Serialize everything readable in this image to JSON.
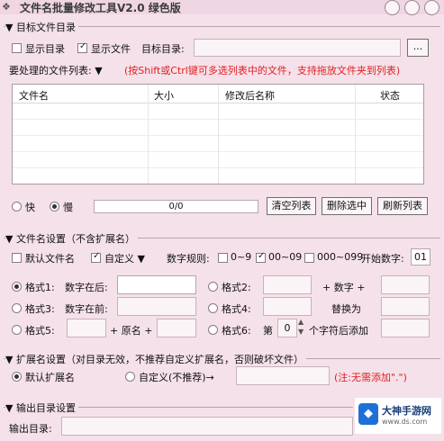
{
  "window": {
    "title": "文件名批量修改工具V2.0  绿色版",
    "icon": "app-icon"
  },
  "target_dir": {
    "group_title": "目标文件目录",
    "show_dirs_label": "显示目录",
    "show_dirs_checked": false,
    "show_files_label": "显示文件",
    "show_files_checked": true,
    "dir_label": "目标目录:",
    "dir_value": "",
    "browse_label": "..."
  },
  "file_list": {
    "heading": "要处理的文件列表: ▼",
    "hint": "(按Shift或Ctrl键可多选列表中的文件，支持拖放文件夹到列表)",
    "columns": [
      "文件名",
      "大小",
      "修改后名称",
      "状态"
    ],
    "rows": []
  },
  "speed": {
    "fast_label": "快",
    "slow_label": "慢",
    "selected": "slow"
  },
  "progress": {
    "text": "0/0",
    "fraction": 0
  },
  "actions": {
    "clear_label": "清空列表",
    "delete_label": "删除选中",
    "refresh_label": "刷新列表"
  },
  "filename": {
    "group_title": "文件名设置（不含扩展名）",
    "default_name_label": "默认文件名",
    "default_name_checked": false,
    "custom_label": "自定义 ▼",
    "custom_checked": true,
    "digit_rule_label": "数字规则:",
    "rule_0_9": "0~9",
    "rule_0_9_checked": false,
    "rule_00_99": "00~09",
    "rule_00_99_checked": true,
    "rule_000_099": "000~099",
    "rule_000_099_checked": false,
    "start_label": "开始数字:",
    "start_value": "01",
    "format1": "格式1:",
    "format1_desc": "数字在后:",
    "format2": "格式2:",
    "plus_digit": "+ 数字 +",
    "format3": "格式3:",
    "format3_desc": "数字在前:",
    "format4": "格式4:",
    "replace_label": "替换为",
    "format5": "格式5:",
    "plus_name_plus": "+ 原名 +",
    "format6": "格式6:",
    "format6_di": "第",
    "format6_count": "0",
    "format6_suffix": "个字符后添加",
    "selected_format": "format1"
  },
  "extension": {
    "group_title": "扩展名设置（对目录无效，不推荐自定义扩展名，否则破坏文件）",
    "default_label": "默认扩展名",
    "custom_label": "自定义(不推荐)→",
    "note": "(注:无需添加\".\")",
    "selected": "default"
  },
  "output": {
    "group_title": "输出目录设置",
    "dir_label": "输出目录:",
    "dir_value": ""
  },
  "watermark": {
    "name": "大神手游网",
    "url": "www.ds.com"
  },
  "colors": {
    "background": "#f5e1ea",
    "accent_red": "#e02020",
    "watermark_blue": "#1f6fd8"
  }
}
